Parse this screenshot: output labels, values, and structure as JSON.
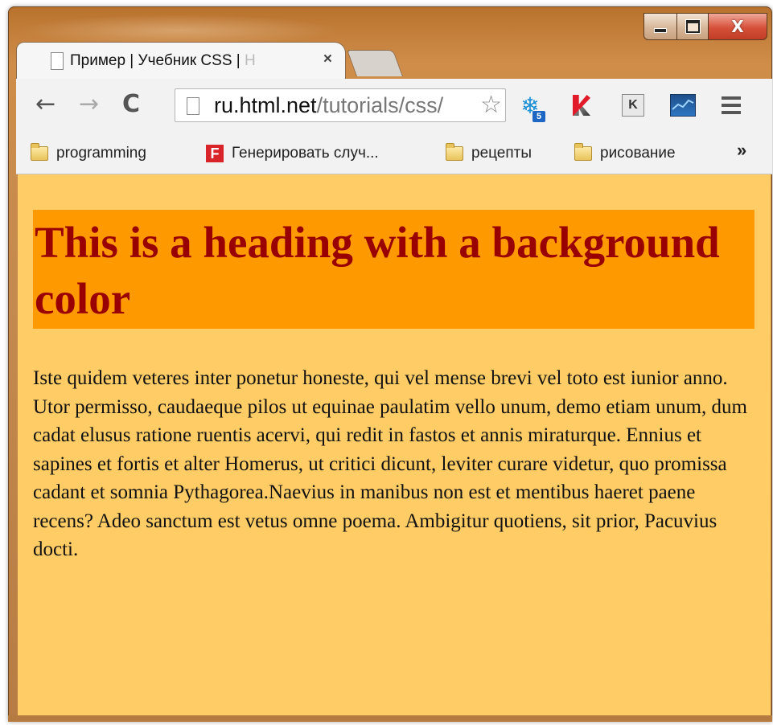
{
  "window": {
    "tab_title_main": "Пример | Учебник CSS | ",
    "tab_title_fade": "Н",
    "tab_close": "×",
    "min_label": "",
    "close_glyph": "X"
  },
  "toolbar": {
    "back": "←",
    "forward": "→",
    "reload": "C",
    "url_host": "ru.html.net",
    "url_path": "/tutorials/css/",
    "star": "☆",
    "snow": "❄",
    "snow_badge": "5",
    "kbox": "K",
    "menu_icon": "hamburger-menu"
  },
  "bookmarks": {
    "items": [
      {
        "label": "programming",
        "icon": "folder-icon"
      },
      {
        "label": "Генерировать случ...",
        "icon": "f-icon"
      },
      {
        "label": "рецепты",
        "icon": "folder-icon"
      },
      {
        "label": "рисование",
        "icon": "folder-icon"
      }
    ],
    "f_letter": "F",
    "overflow": "»"
  },
  "page": {
    "heading": "This is a heading with a background color",
    "paragraph": "Iste quidem veteres inter ponetur honeste, qui vel mense brevi vel toto est iunior anno. Utor permisso, caudaeque pilos ut equinae paulatim vello unum, demo etiam unum, dum cadat elusus ratione ruentis acervi, qui redit in fastos et annis miraturque. Ennius et sapines et fortis et alter Homerus, ut critici dicunt, leviter curare videtur, quo promissa cadant et somnia Pythagorea.Naevius in manibus non est et mentibus haeret paene recens? Adeo sanctum est vetus omne poema. Ambigitur quotiens, sit prior, Pacuvius docti.",
    "colors": {
      "body_bg": "#ffcc66",
      "heading_bg": "#ff9900",
      "heading_text": "#990000"
    }
  }
}
